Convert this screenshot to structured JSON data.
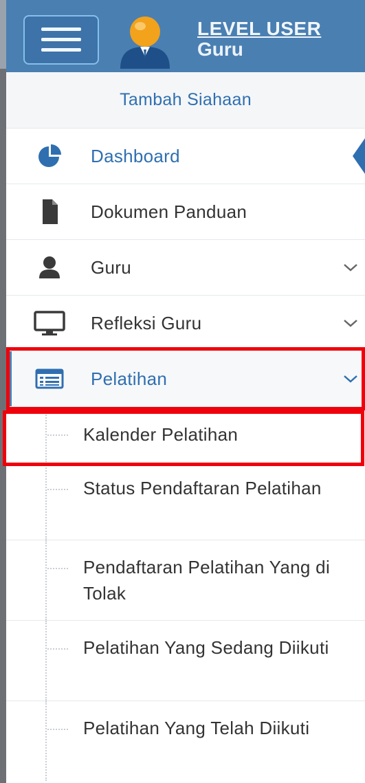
{
  "header": {
    "user_title": "LEVEL USER",
    "user_role": "Guru"
  },
  "menu": {
    "add_link": "Tambah Siahaan",
    "items": [
      {
        "label": "Dashboard",
        "icon": "pie-chart-icon",
        "active": true
      },
      {
        "label": "Dokumen Panduan",
        "icon": "document-icon"
      },
      {
        "label": "Guru",
        "icon": "user-icon",
        "expandable": true
      },
      {
        "label": "Refleksi Guru",
        "icon": "monitor-icon",
        "expandable": true
      },
      {
        "label": "Pelatihan",
        "icon": "list-icon",
        "expandable": true,
        "expanded": true
      }
    ],
    "submenu": [
      {
        "label": "Kalender Pelatihan"
      },
      {
        "label": "Status Pendaftaran Pelatihan"
      },
      {
        "label": "Pendaftaran Pelatihan Yang di Tolak"
      },
      {
        "label": "Pelatihan Yang Sedang Diikuti"
      },
      {
        "label": "Pelatihan Yang Telah Diikuti"
      }
    ]
  },
  "colors": {
    "header_bg": "#4a7fb2",
    "accent_blue": "#2f6fb0",
    "highlight_red": "#f0000a"
  }
}
